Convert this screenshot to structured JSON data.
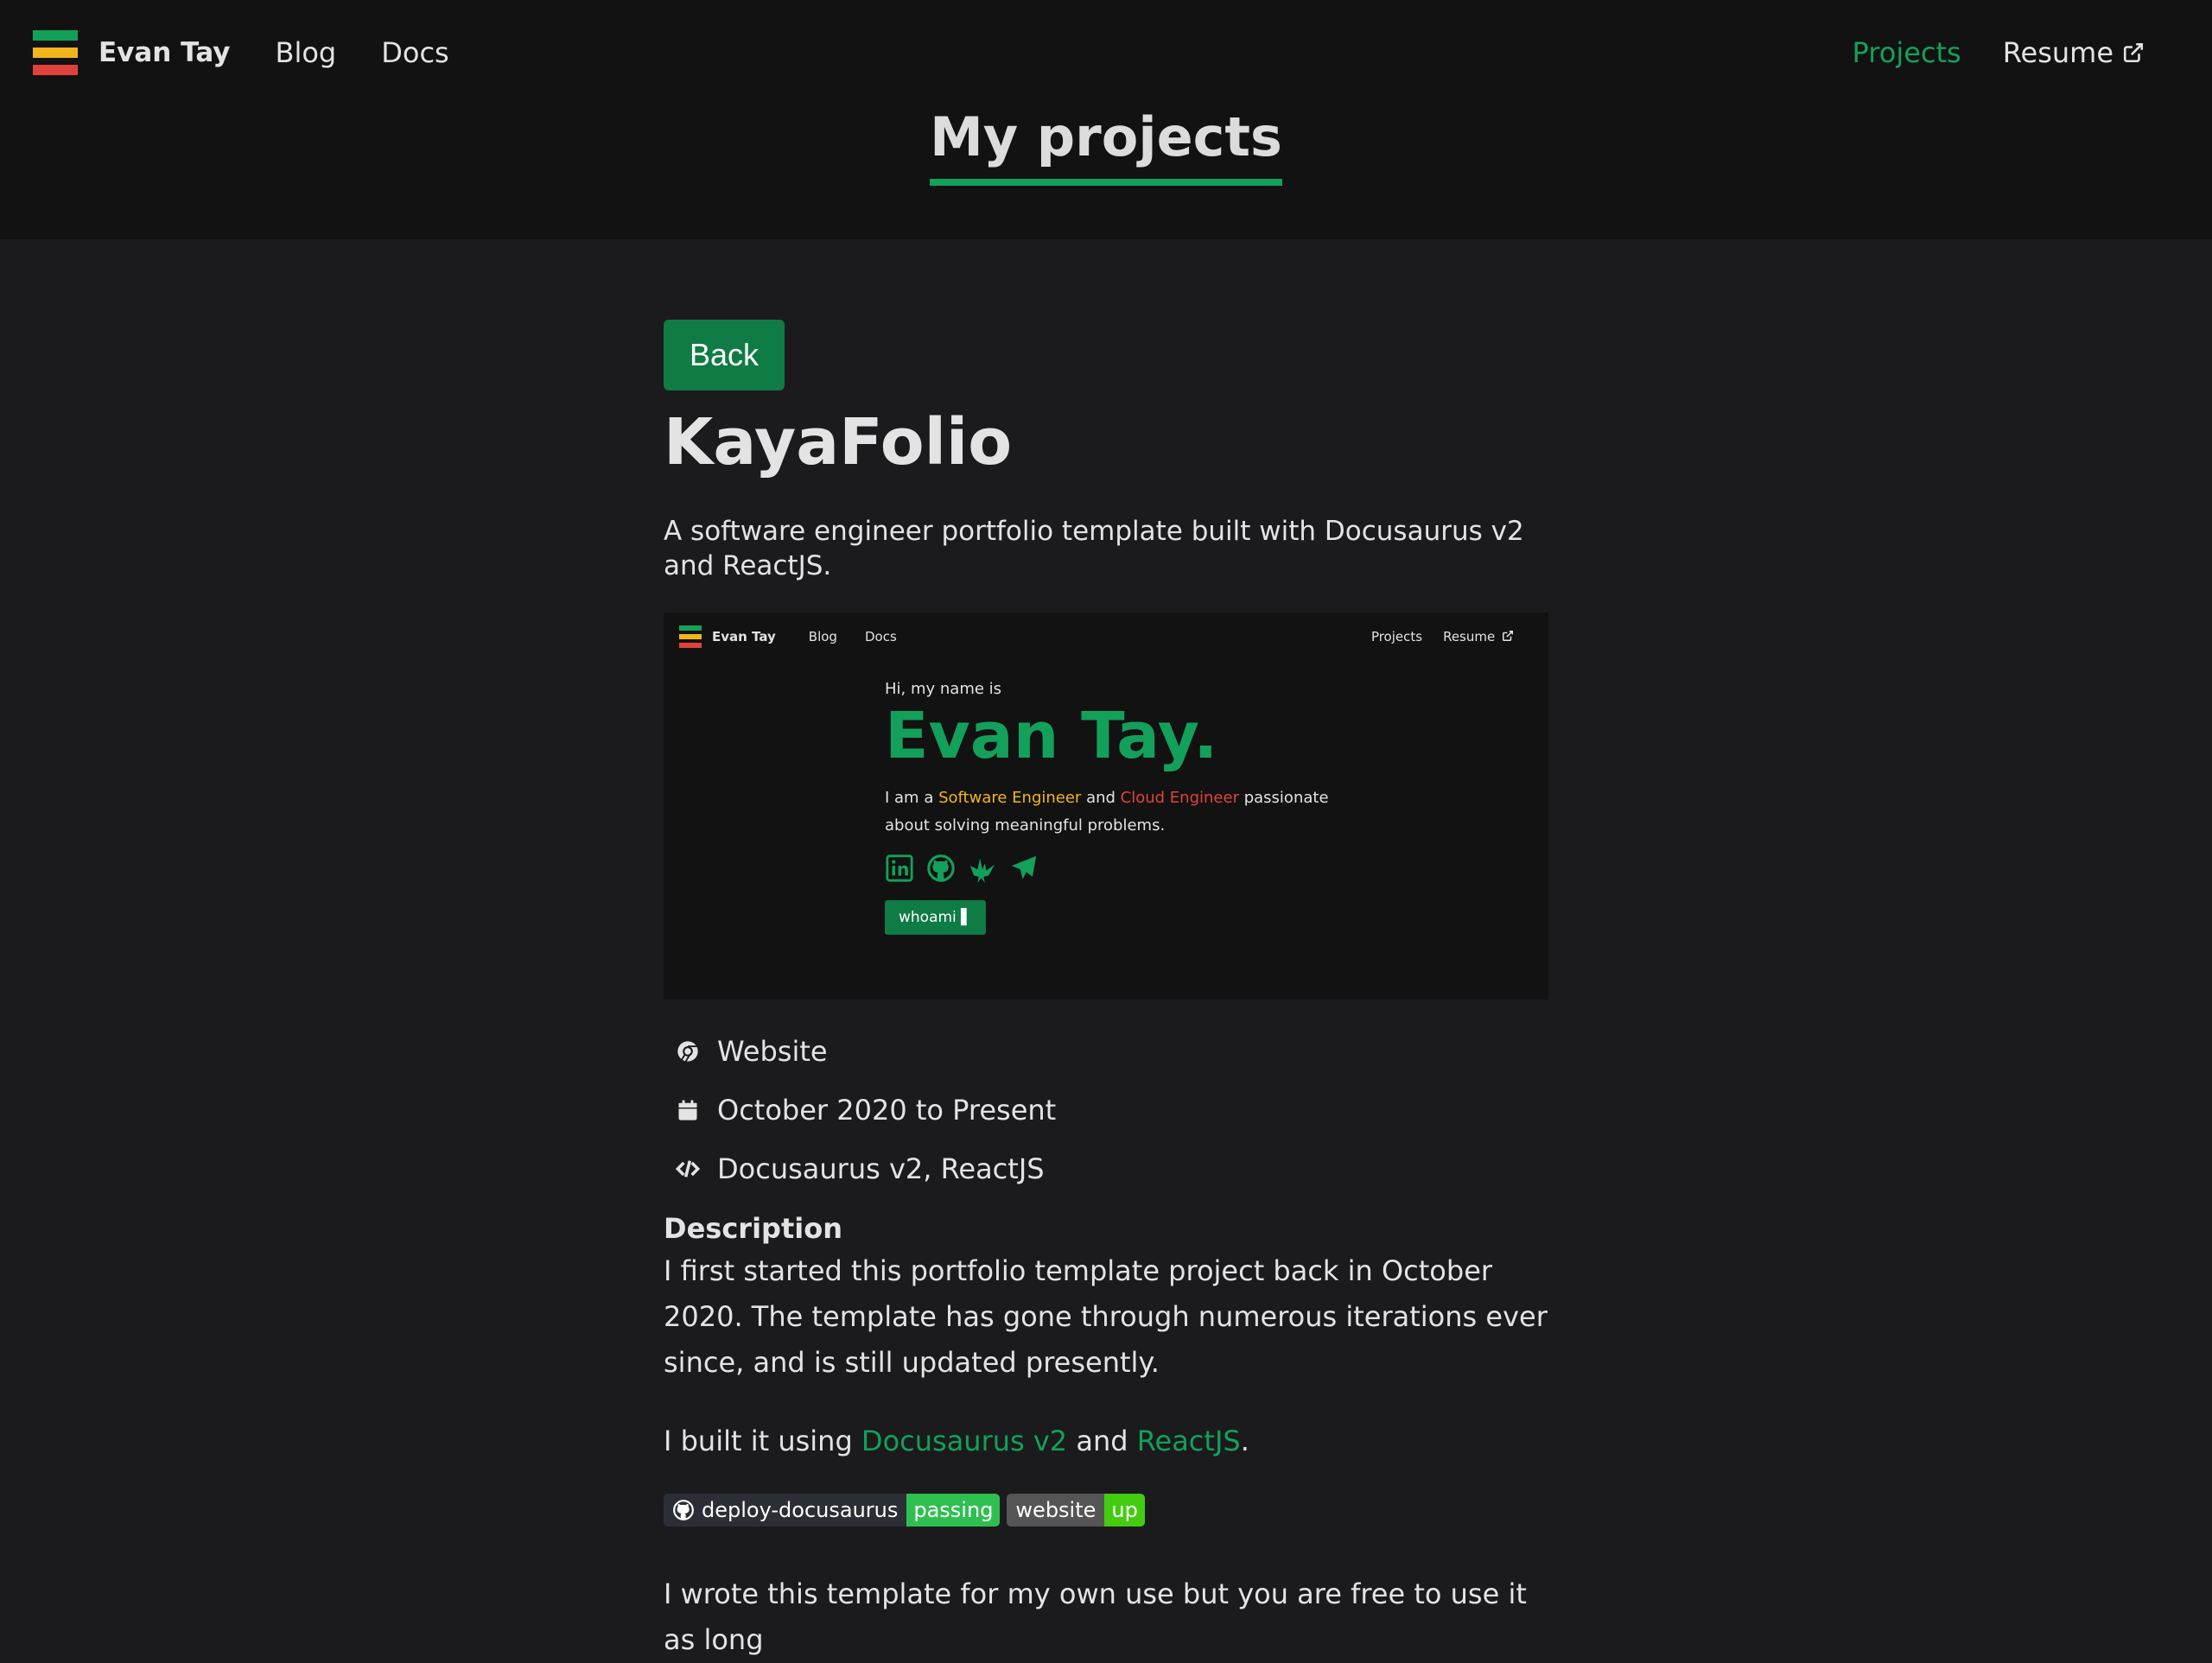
{
  "nav": {
    "brand": "Evan Tay",
    "links": [
      "Blog",
      "Docs"
    ],
    "right_links": [
      "Projects",
      "Resume"
    ],
    "active": "Projects",
    "logo_colors": [
      "#13a05a",
      "#f3b51a",
      "#e0433b"
    ]
  },
  "header": {
    "title": "My projects"
  },
  "main": {
    "back_label": "Back",
    "title": "KayaFolio",
    "subtitle": "A software engineer portfolio template built with Docusaurus v2 and ReactJS.",
    "preview": {
      "nav_brand": "Evan Tay",
      "nav_links": [
        "Blog",
        "Docs"
      ],
      "nav_right": [
        "Projects",
        "Resume"
      ],
      "hi": "Hi, my name is",
      "name": "Evan Tay.",
      "desc_prefix": "I am a",
      "role1": "Software Engineer",
      "and": "and",
      "role2": "Cloud Engineer",
      "desc_suffix": "passionate about solving meaningful problems.",
      "icons": [
        "linkedin-icon",
        "github-icon",
        "origami-crane-icon",
        "paper-plane-icon"
      ],
      "button": "whoami ▌"
    },
    "meta": {
      "type": "Website",
      "dates": "October 2020 to Present",
      "tech": "Docusaurus v2, ReactJS"
    },
    "description_heading": "Description",
    "description_p1": "I first started this portfolio template project back in October 2020. The template has gone through numerous iterations ever since, and is still updated presently.",
    "description_p2_prefix": "I built it using",
    "link_docusaurus": "Docusaurus v2",
    "and": "and",
    "link_react": "ReactJS",
    "period": ".",
    "badges": [
      {
        "label": "deploy-docusaurus",
        "status": "passing",
        "color": "#2fbf50"
      },
      {
        "label": "website",
        "status": "up",
        "color": "#44cc11"
      }
    ],
    "description_p3": "I wrote this template for my own use but you are free to use it as long"
  },
  "colors": {
    "accent": "#13a05a",
    "button": "#0f7b45",
    "background": "#1b1b1d",
    "navbar": "#121212"
  }
}
